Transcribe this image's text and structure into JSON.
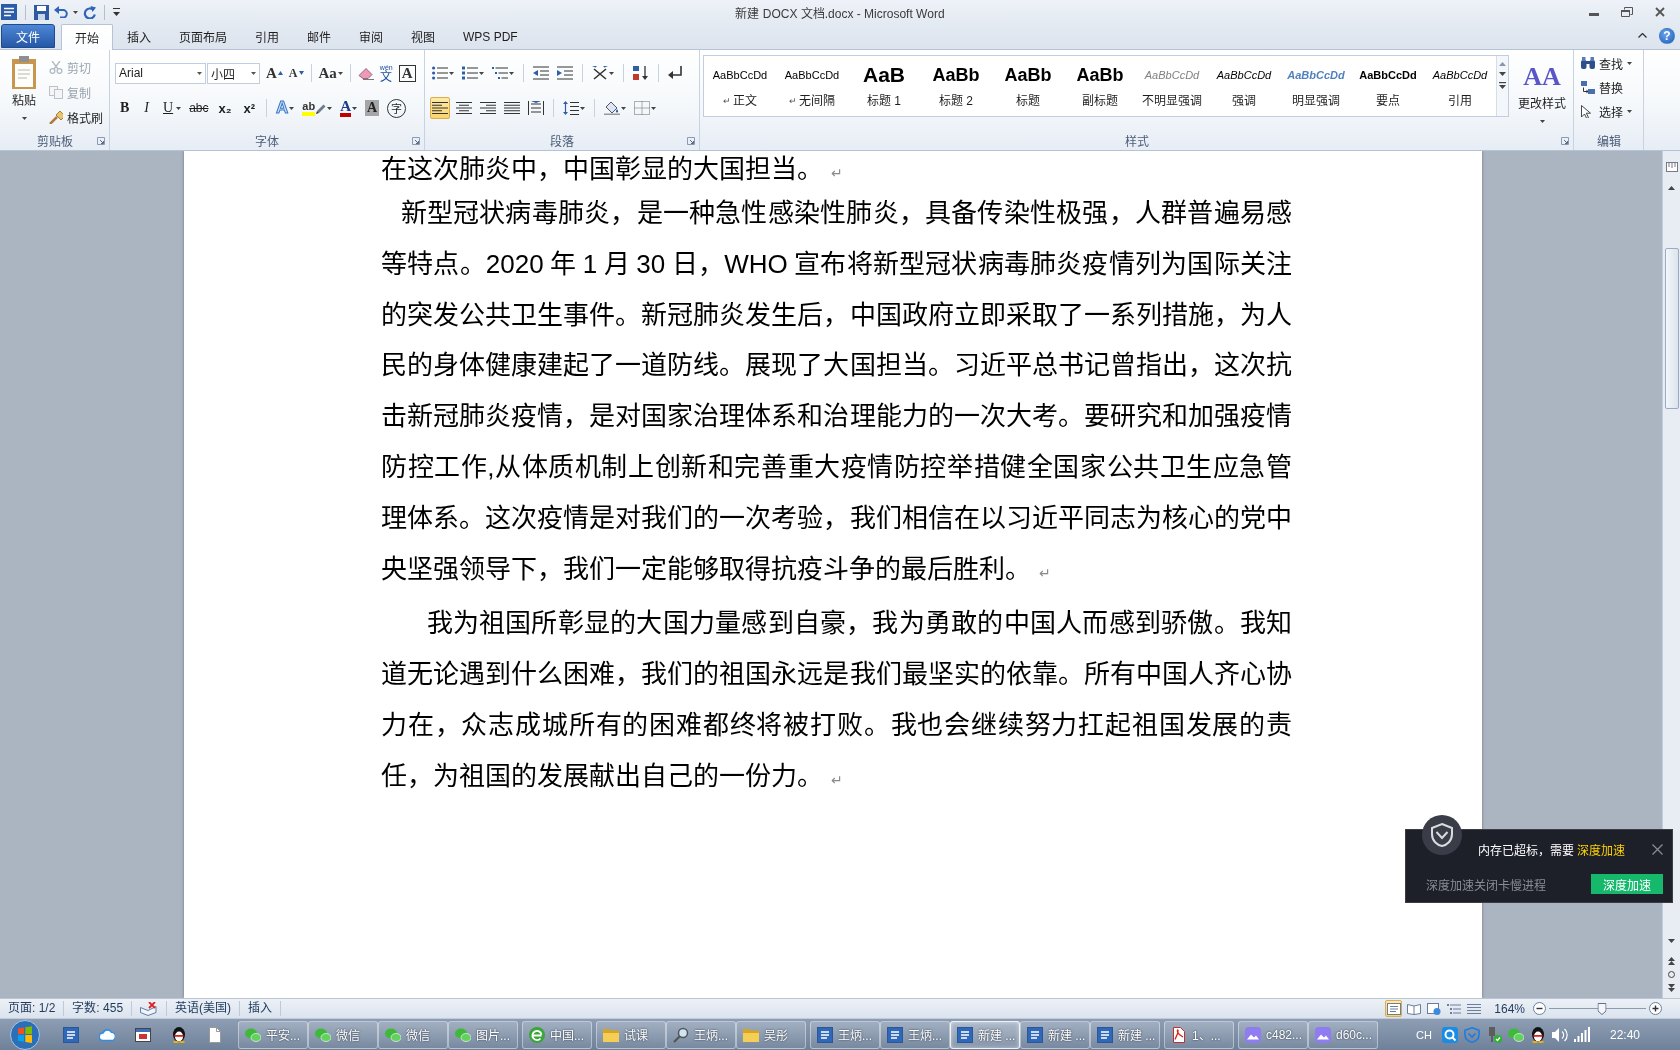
{
  "window": {
    "title": "新建 DOCX 文档.docx - Microsoft Word"
  },
  "tabs": [
    {
      "label": "文件",
      "kind": "file",
      "selected": false
    },
    {
      "label": "开始",
      "kind": "tab",
      "selected": true
    },
    {
      "label": "插入",
      "kind": "tab",
      "selected": false
    },
    {
      "label": "页面布局",
      "kind": "tab",
      "selected": false
    },
    {
      "label": "引用",
      "kind": "tab",
      "selected": false
    },
    {
      "label": "邮件",
      "kind": "tab",
      "selected": false
    },
    {
      "label": "审阅",
      "kind": "tab",
      "selected": false
    },
    {
      "label": "视图",
      "kind": "tab",
      "selected": false
    },
    {
      "label": "WPS PDF",
      "kind": "tab",
      "selected": false
    }
  ],
  "help_button": {
    "glyph": "?"
  },
  "ribbon": {
    "clipboard": {
      "label": "剪贴板",
      "paste": "粘贴",
      "tools": [
        {
          "label": "剪切",
          "disabled": true
        },
        {
          "label": "复制",
          "disabled": true
        },
        {
          "label": "格式刷",
          "disabled": false
        }
      ]
    },
    "font": {
      "label": "字体",
      "font_name": "Arial",
      "font_size": "小四",
      "top_row": [
        {
          "kind": "grow",
          "glyph": "A"
        },
        {
          "kind": "shrink",
          "glyph": "A"
        },
        {
          "kind": "case",
          "glyph": "Aa"
        },
        {
          "kind": "clear"
        },
        {
          "kind": "phonetic",
          "glyph": "文",
          "ruby": "wén"
        },
        {
          "kind": "border",
          "glyph": "A"
        }
      ],
      "bottom_row": [
        {
          "kind": "bold",
          "glyph": "B"
        },
        {
          "kind": "italic",
          "glyph": "I"
        },
        {
          "kind": "underline",
          "glyph": "U"
        },
        {
          "kind": "strike",
          "glyph": "abc"
        },
        {
          "kind": "subscript",
          "glyph": "x₂"
        },
        {
          "kind": "superscript",
          "glyph": "x²"
        },
        {
          "kind": "effects",
          "glyph": "A"
        },
        {
          "kind": "highlight",
          "glyph": "ab"
        },
        {
          "kind": "color",
          "glyph": "A"
        },
        {
          "kind": "shading",
          "glyph": "A"
        },
        {
          "kind": "enclosed",
          "glyph": "字"
        }
      ]
    },
    "paragraph": {
      "label": "段落",
      "top_row": [
        {
          "kind": "bullets"
        },
        {
          "kind": "numbering"
        },
        {
          "kind": "multilevel"
        },
        {
          "kind": "outdent"
        },
        {
          "kind": "indent"
        },
        {
          "kind": "asian"
        },
        {
          "kind": "sort"
        },
        {
          "kind": "marks"
        }
      ],
      "bottom_row": [
        {
          "kind": "left",
          "selected": true
        },
        {
          "kind": "center",
          "selected": false
        },
        {
          "kind": "right",
          "selected": false
        },
        {
          "kind": "justify",
          "selected": false
        },
        {
          "kind": "distribute",
          "selected": false
        },
        {
          "kind": "spacing"
        },
        {
          "kind": "shading"
        },
        {
          "kind": "borders"
        }
      ]
    },
    "styles": {
      "label": "样式",
      "gallery": [
        {
          "preview": "AaBbCcDd",
          "name": "正文",
          "mark": "↵",
          "kind": "normal"
        },
        {
          "preview": "AaBbCcDd",
          "name": "无间隔",
          "mark": "↵",
          "kind": "normal"
        },
        {
          "preview": "AaB",
          "name": "标题 1",
          "kind": "heading1"
        },
        {
          "preview": "AaBb",
          "name": "标题 2",
          "kind": "heading2"
        },
        {
          "preview": "AaBb",
          "name": "标题",
          "kind": "title"
        },
        {
          "preview": "AaBb",
          "name": "副标题",
          "kind": "subtitle"
        },
        {
          "preview": "AaBbCcDd",
          "name": "不明显强调",
          "kind": "subtle"
        },
        {
          "preview": "AaBbCcDd",
          "name": "强调",
          "kind": "emphasis"
        },
        {
          "preview": "AaBbCcDd",
          "name": "明显强调",
          "kind": "intense"
        },
        {
          "preview": "AaBbCcDd",
          "name": "要点",
          "kind": "strong"
        },
        {
          "preview": "AaBbCcDd",
          "name": "引用",
          "kind": "quote"
        }
      ],
      "change": {
        "glyph": "AA",
        "label": "更改样式"
      }
    },
    "editing": {
      "label": "编辑",
      "tools": [
        {
          "label": "查找",
          "dropdown": true
        },
        {
          "label": "替换",
          "dropdown": false
        },
        {
          "label": "选择",
          "dropdown": true
        }
      ]
    }
  },
  "document": {
    "paragraphs": [
      {
        "text": "在这次肺炎中，中国彰显的大国担当。",
        "mark": "↵"
      },
      {
        "text": "新型冠状病毒肺炎，是一种急性感染性肺炎，具备传染性极强，人群普遍易感等特点。2020 年 1 月 30 日，WHO 宣布将新型冠状病毒肺炎疫情列为国际关注的突发公共卫生事件。新冠肺炎发生后，中国政府立即采取了一系列措施，为人民的身体健康建起了一道防线。展现了大国担当。习近平总书记曾指出，这次抗击新冠肺炎疫情，是对国家治理体系和治理能力的一次大考。要研究和加强疫情防控工作,从体质机制上创新和完善重大疫情防控举措健全国家公共卫生应急管理体系。这次疫情是对我们的一次考验，我们相信在以习近平同志为核心的党中央坚强领导下，我们一定能够取得抗疫斗争的最后胜利。",
        "mark": "↵"
      },
      {
        "text": "我为祖国所彰显的大国力量感到自豪，我为勇敢的中国人而感到骄傲。我知道无论遇到什么困难，我们的祖国永远是我们最坚实的依靠。所有中国人齐心协力在，众志成城所有的困难都终将被打败。我也会继续努力扛起祖国发展的责任，为祖国的发展献出自己的一份力。",
        "mark": "↵"
      }
    ]
  },
  "notification": {
    "message": "内存已超标，需要",
    "link": "深度加速",
    "detail": "深度加速关闭卡慢进程",
    "button": "深度加速"
  },
  "status_bar": {
    "page": "页面: 1/2",
    "words": "字数: 455",
    "language": "英语(美国)",
    "mode": "插入",
    "views": [
      {
        "kind": "print",
        "selected": true
      },
      {
        "kind": "reading",
        "selected": false
      },
      {
        "kind": "web",
        "selected": false
      },
      {
        "kind": "outline",
        "selected": false
      },
      {
        "kind": "draft",
        "selected": false
      }
    ],
    "zoom": "164%",
    "zoom_slider": {
      "level": 0.55
    }
  },
  "taskbar": {
    "pinned": [
      {
        "kind": "document"
      },
      {
        "kind": "cloud"
      },
      {
        "kind": "window"
      },
      {
        "kind": "penguin"
      },
      {
        "kind": "page"
      }
    ],
    "groups": [
      {
        "tasks": [
          {
            "label": "平安...",
            "kind": "chat",
            "selected": false
          },
          {
            "label": "微信",
            "kind": "chat",
            "selected": false
          },
          {
            "label": "微信",
            "kind": "chat",
            "selected": false
          },
          {
            "label": "图片...",
            "kind": "chat",
            "selected": false
          }
        ]
      },
      {
        "tasks": [
          {
            "label": "中国...",
            "kind": "browser",
            "selected": false
          }
        ]
      },
      {
        "tasks": [
          {
            "label": "试课",
            "kind": "folder",
            "selected": false
          },
          {
            "label": "王炳...",
            "kind": "search",
            "selected": false
          },
          {
            "label": "吴彤",
            "kind": "folder",
            "selected": false
          }
        ]
      },
      {
        "tasks": [
          {
            "label": "王炳...",
            "kind": "word",
            "selected": false
          },
          {
            "label": "王炳...",
            "kind": "word",
            "selected": false
          },
          {
            "label": "新建 ...",
            "kind": "word",
            "selected": true
          },
          {
            "label": "新建 ...",
            "kind": "word",
            "selected": false
          },
          {
            "label": "新建 ...",
            "kind": "word",
            "selected": false
          }
        ]
      },
      {
        "tasks": [
          {
            "label": "1、...",
            "kind": "pdf",
            "selected": false
          }
        ]
      },
      {
        "tasks": [
          {
            "label": "c482...",
            "kind": "image",
            "selected": false
          },
          {
            "label": "d60c...",
            "kind": "image",
            "selected": false
          }
        ]
      }
    ],
    "tray": {
      "language": "CH",
      "time": "22:40"
    }
  }
}
